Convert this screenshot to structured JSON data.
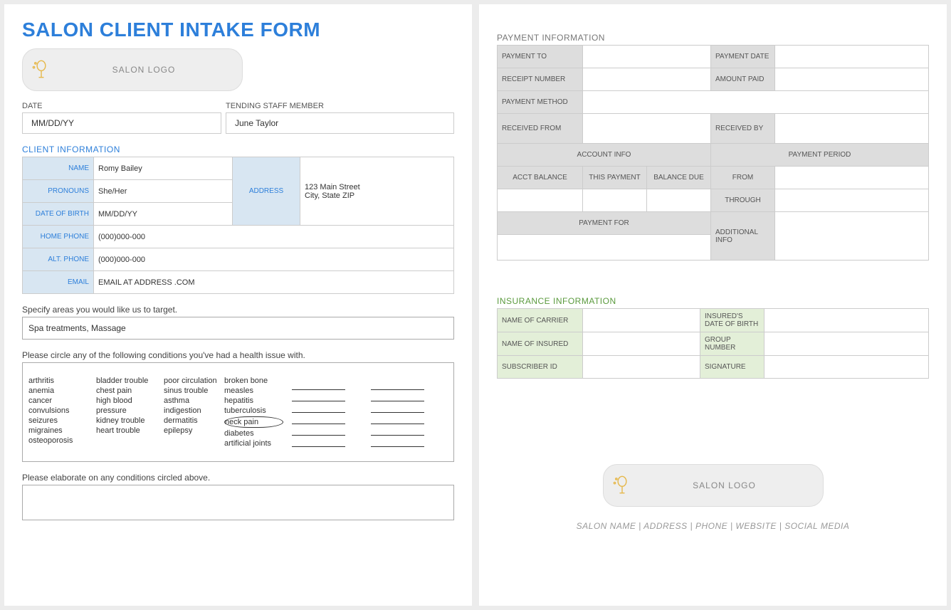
{
  "title": "SALON CLIENT INTAKE FORM",
  "logo_label": "SALON LOGO",
  "date": {
    "label": "DATE",
    "value": "MM/DD/YY"
  },
  "staff": {
    "label": "TENDING STAFF MEMBER",
    "value": "June Taylor"
  },
  "client_info_hdr": "CLIENT INFORMATION",
  "client": {
    "name_label": "NAME",
    "name": "Romy Bailey",
    "pronouns_label": "PRONOUNS",
    "pronouns": "She/Her",
    "dob_label": "DATE OF BIRTH",
    "dob": "MM/DD/YY",
    "address_label": "ADDRESS",
    "address_line1": "123 Main Street",
    "address_line2": "City, State ZIP",
    "home_phone_label": "HOME PHONE",
    "home_phone": "(000)000-000",
    "alt_phone_label": "ALT. PHONE",
    "alt_phone": "(000)000-000",
    "email_label": "EMAIL",
    "email": "EMAIL AT ADDRESS .COM"
  },
  "target_label": "Specify areas you would like us to target.",
  "target_value": "Spa treatments, Massage",
  "cond_label": "Please circle any of the following conditions you've had a health issue with.",
  "conditions": {
    "c1": [
      "arthritis",
      "anemia",
      "cancer",
      "convulsions",
      "seizures",
      "migraines",
      "osteoporosis"
    ],
    "c2": [
      "bladder trouble",
      "chest pain",
      "high blood",
      "pressure",
      "kidney trouble",
      "heart trouble"
    ],
    "c3": [
      "poor circulation",
      "sinus trouble",
      "asthma",
      "indigestion",
      "dermatitis",
      "epilepsy"
    ],
    "c4": [
      "broken bone",
      "measles",
      "hepatitis",
      "tuberculosis",
      "neck pain",
      "diabetes",
      "artificial joints"
    ],
    "circled": "neck pain"
  },
  "elab_label": "Please elaborate on any conditions circled above.",
  "payment_hdr": "PAYMENT INFORMATION",
  "payment": {
    "to": "PAYMENT TO",
    "date": "PAYMENT DATE",
    "receipt": "RECEIPT NUMBER",
    "amount": "AMOUNT PAID",
    "method": "PAYMENT METHOD",
    "from": "RECEIVED FROM",
    "by": "RECEIVED BY",
    "acct_hdr": "ACCOUNT INFO",
    "period_hdr": "PAYMENT PERIOD",
    "acct_bal": "ACCT BALANCE",
    "this_pay": "THIS PAYMENT",
    "bal_due": "BALANCE DUE",
    "p_from": "FROM",
    "p_through": "THROUGH",
    "pay_for": "PAYMENT FOR",
    "add_info": "ADDITIONAL INFO"
  },
  "insurance_hdr": "INSURANCE INFORMATION",
  "insurance": {
    "carrier": "NAME OF CARRIER",
    "insured_dob": "INSURED'S DATE OF BIRTH",
    "insured": "NAME OF INSURED",
    "group": "GROUP NUMBER",
    "sub_id": "SUBSCRIBER ID",
    "sig": "SIGNATURE"
  },
  "footer": "SALON NAME   |   ADDRESS   |   PHONE   |   WEBSITE   |   SOCIAL MEDIA"
}
